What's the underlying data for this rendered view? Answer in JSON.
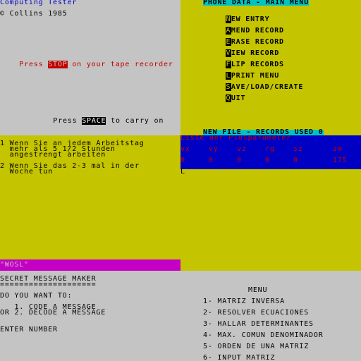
{
  "q1": {
    "title": "Computing Tester",
    "copyright": "© Collins 1985",
    "tape_prefix": "Press ",
    "tape_stop": "STOP",
    "tape_suffix": " on your tape recorder",
    "space_prefix": "Press ",
    "space_key": "SPACE",
    "space_suffix": " to carry on"
  },
  "q2": {
    "title": "PHONE DATA - MAIN MENU",
    "items": [
      {
        "key": "N",
        "rest": "EW ENTRY"
      },
      {
        "key": "A",
        "rest": "MEND RECORD"
      },
      {
        "key": "E",
        "rest": "RASE RECORD"
      },
      {
        "key": "V",
        "rest": "IEW RECORD"
      },
      {
        "key": "F",
        "rest": "LIP RECORDS"
      },
      {
        "key": "L",
        "rest": "PRINT MENU"
      },
      {
        "key": "S",
        "rest": "AVE/LOAD/CREATE"
      },
      {
        "key": "Q",
        "rest": "UIT"
      }
    ],
    "status": "NEW FILE - RECORDS USED 0"
  },
  "q3": {
    "line1a": "1 Wenn Sie an jedem Arbeitstag",
    "line1b": "  mehr als 5 1/2 Stunden",
    "line1c": "  angestrengt arbeiten",
    "line2a": "2 Wenn Sie das 2-3 mal in der",
    "line2b": "  Woche tun",
    "footer": "\"WOSL\""
  },
  "q4": {
    "title": "Liste der Plotparameter",
    "headers": [
      "vx",
      "vy",
      "vz",
      "rg",
      "sz",
      "zm"
    ],
    "values": [
      "0",
      "0",
      "0",
      "0",
      "0",
      "175"
    ],
    "cursor": "L"
  },
  "q5": {
    "title": "SECRET MESSAGE MAKER",
    "rule": "====================",
    "question": "DO YOU WANT TO:",
    "opt1": "   1. CODE A MESSAGE",
    "opt2": "OR 2. DECODE A MESSAGE",
    "prompt": "ENTER NUMBER"
  },
  "q6": {
    "title": "MENU",
    "items": [
      "1- MATRIZ INVERSA",
      "2- RESOLVER ECUACIONES",
      "3- HALLAR DETERMINANTES",
      "4- MAX. COMUN DENOMINADOR",
      "5- ORDEN DE UNA MATRIZ",
      "6- INPUT MATRIZ"
    ]
  },
  "colors": {
    "grey": "#c4c4c4",
    "yellow": "#c4c400",
    "blue": "#0000c4",
    "magenta": "#c400c4",
    "cyan": "#00c4c4",
    "red": "#c40000"
  }
}
